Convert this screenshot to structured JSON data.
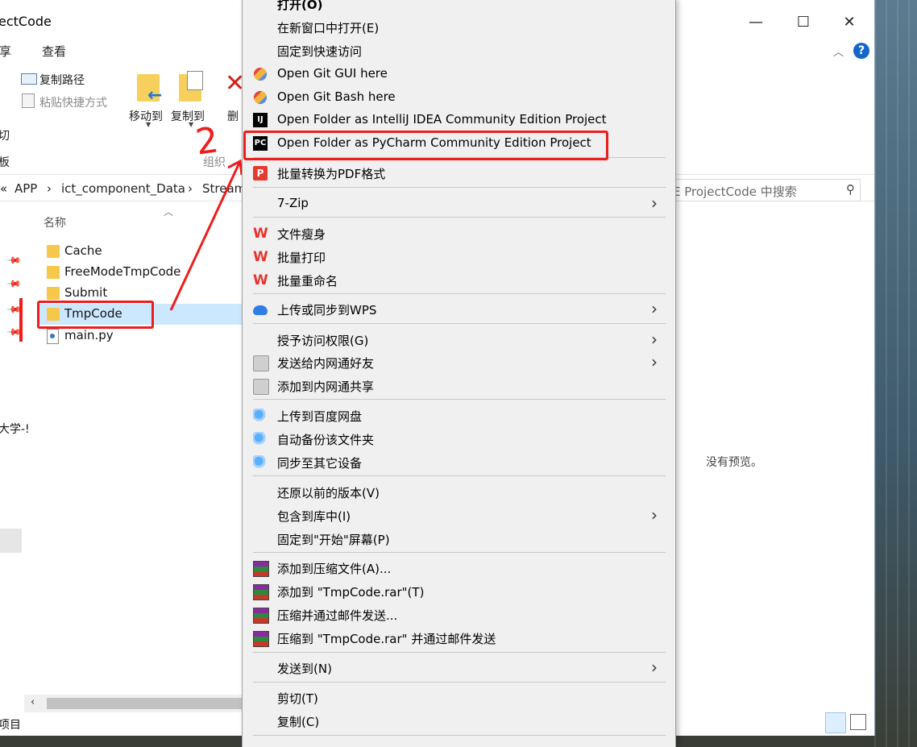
{
  "window": {
    "title": "ectCode",
    "minimize": "—",
    "maximize": "☐",
    "close": "✕",
    "help": "?"
  },
  "menu_tabs": [
    "享",
    "查看"
  ],
  "ribbon": {
    "copy_path": "复制路径",
    "paste_shortcut": "粘贴快捷方式",
    "move_to": "移动到",
    "copy_to": "复制到",
    "delete": "删",
    "cut": "切",
    "clipboard_group": "板",
    "organize_group": "组织"
  },
  "address": {
    "back_glyph": "«",
    "crumbs": [
      "APP",
      "ict_component_Data",
      "Stream"
    ],
    "separator": "›",
    "search_placeholder": "E ProjectCode 中搜索"
  },
  "file_list": {
    "column_name": "名称",
    "items": [
      {
        "name": "Cache",
        "type": "folder"
      },
      {
        "name": "FreeModeTmpCode",
        "type": "folder"
      },
      {
        "name": "Submit",
        "type": "folder"
      },
      {
        "name": "TmpCode",
        "type": "folder",
        "selected": true
      },
      {
        "name": "main.py",
        "type": "python"
      }
    ]
  },
  "nav_pane": {
    "partial_item": "大学-!"
  },
  "status_bar": {
    "items_label": "项目"
  },
  "preview": {
    "no_preview": "没有预览。"
  },
  "context_menu": {
    "items": [
      {
        "label": "打开(O)",
        "icon": "none",
        "bold": true
      },
      {
        "label": "在新窗口中打开(E)",
        "icon": "none"
      },
      {
        "label": "固定到快速访问",
        "icon": "none"
      },
      {
        "label": "Open Git GUI here",
        "icon": "git-icon"
      },
      {
        "label": "Open Git Bash here",
        "icon": "git-icon"
      },
      {
        "label": "Open Folder as IntelliJ IDEA Community Edition Project",
        "icon": "intellij-icon"
      },
      {
        "label": "Open Folder as PyCharm Community Edition Project",
        "icon": "pycharm-icon"
      },
      {
        "label": "批量转换为PDF格式",
        "icon": "pdf-icon"
      },
      {
        "label": "7-Zip",
        "icon": "none",
        "submenu": true
      },
      {
        "label": "文件瘦身",
        "icon": "wps-icon"
      },
      {
        "label": "批量打印",
        "icon": "wps-icon"
      },
      {
        "label": "批量重命名",
        "icon": "wps-icon"
      },
      {
        "label": "上传或同步到WPS",
        "icon": "wps-cloud-icon",
        "submenu": true
      },
      {
        "label": "授予访问权限(G)",
        "icon": "none",
        "submenu": true
      },
      {
        "label": "发送给内网通好友",
        "icon": "share-icon",
        "submenu": true
      },
      {
        "label": "添加到内网通共享",
        "icon": "share-icon"
      },
      {
        "label": "上传到百度网盘",
        "icon": "baidu-icon"
      },
      {
        "label": "自动备份该文件夹",
        "icon": "baidu-icon"
      },
      {
        "label": "同步至其它设备",
        "icon": "baidu-icon"
      },
      {
        "label": "还原以前的版本(V)",
        "icon": "none"
      },
      {
        "label": "包含到库中(I)",
        "icon": "none",
        "submenu": true
      },
      {
        "label": "固定到\"开始\"屏幕(P)",
        "icon": "none"
      },
      {
        "label": "添加到压缩文件(A)...",
        "icon": "winrar-icon"
      },
      {
        "label": "添加到 \"TmpCode.rar\"(T)",
        "icon": "winrar-icon"
      },
      {
        "label": "压缩并通过邮件发送...",
        "icon": "winrar-icon"
      },
      {
        "label": "压缩到 \"TmpCode.rar\" 并通过邮件发送",
        "icon": "winrar-icon"
      },
      {
        "label": "发送到(N)",
        "icon": "none",
        "submenu": true
      },
      {
        "label": "剪切(T)",
        "icon": "none"
      },
      {
        "label": "复制(C)",
        "icon": "none"
      }
    ]
  },
  "annotation": {
    "step_number": "2",
    "color": "#ee1d1d"
  },
  "colors": {
    "selection": "#cce8ff",
    "menu_bg": "#f0f0f0",
    "annotation": "#ee1d1d"
  }
}
